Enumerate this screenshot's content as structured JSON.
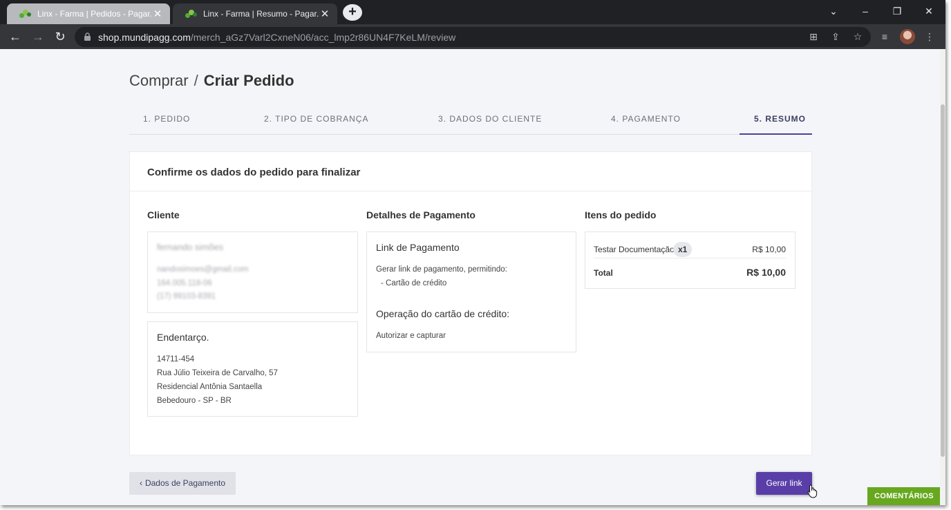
{
  "browser": {
    "tabs": [
      {
        "title": "Linx - Farma | Pedidos - Pagar.me",
        "active": false
      },
      {
        "title": "Linx - Farma | Resumo - Pagar.me",
        "active": true
      }
    ],
    "url_domain": "shop.mundipagg.com",
    "url_path": "/merch_aGz7Varl2CxneN06/acc_lmp2r86UN4F7KeLM/review"
  },
  "breadcrumb": {
    "parent": "Comprar",
    "separator": "/",
    "current": "Criar Pedido"
  },
  "steps": [
    {
      "label": "1. PEDIDO",
      "active": false
    },
    {
      "label": "2. TIPO DE COBRANÇA",
      "active": false
    },
    {
      "label": "3. DADOS DO CLIENTE",
      "active": false
    },
    {
      "label": "4. PAGAMENTO",
      "active": false
    },
    {
      "label": "5. RESUMO",
      "active": true
    }
  ],
  "card": {
    "title": "Confirme os dados do pedido para finalizar"
  },
  "cliente": {
    "heading": "Cliente",
    "name": "fernando simões",
    "email": "nandosimoes@gmail.com",
    "document": "164.005.118-06",
    "phone": "(17) 99103-8391",
    "address_title": "Endentarço.",
    "zip": "14711-454",
    "street": "Rua Júlio Teixeira de Carvalho, 57",
    "district": "Residencial Antônia Santaella",
    "city": "Bebedouro - SP - BR"
  },
  "pagamento": {
    "heading": "Detalhes de Pagamento",
    "method_title": "Link de Pagamento",
    "desc": "Gerar link de pagamento, permitindo:",
    "item": "- Cartão de crédito",
    "op_title": "Operação do cartão de crédito:",
    "op_value": "Autorizar e capturar"
  },
  "itens": {
    "heading": "Itens do pedido",
    "product": "Testar Documentação",
    "qty": "x1",
    "price": "R$ 10,00",
    "total_label": "Total",
    "total_value": "R$ 10,00"
  },
  "actions": {
    "back": "Dados de Pagamento",
    "generate": "Gerar link"
  },
  "feedback": {
    "label": "COMENTÁRIOS"
  },
  "colors": {
    "accent": "#5a3ea8",
    "comments": "#67a81f",
    "chrome_dark": "#202124"
  }
}
